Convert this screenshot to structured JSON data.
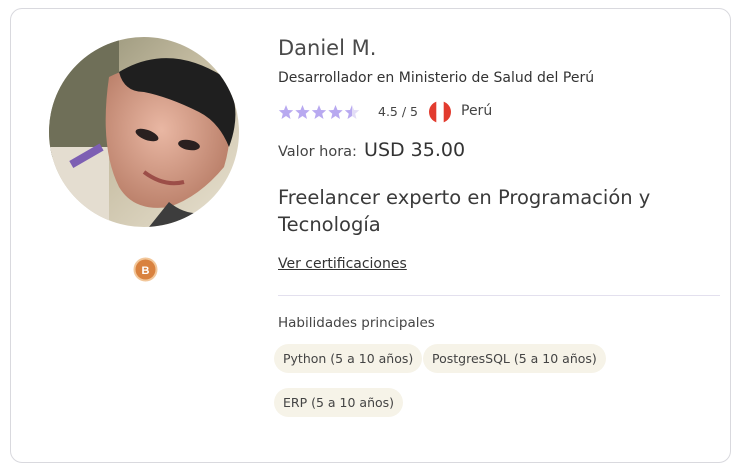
{
  "profile": {
    "name": "Daniel M.",
    "role": "Desarrollador en Ministerio de Salud del Perú",
    "rating": 4.5,
    "rating_text": "4.5 / 5",
    "country": "Perú",
    "rate_label": "Valor hora:",
    "rate_value": "USD 35.00",
    "headline": "Freelancer experto en Programación y Tecnología",
    "cert_link": "Ver certificaciones",
    "badge_letter": "B",
    "skills_title": "Habilidades principales",
    "skills": [
      "Python (5 a 10 años)",
      "PostgresSQL (5 a 10 años)",
      "ERP (5 a 10 años)"
    ]
  },
  "colors": {
    "star": "#b8a9f0",
    "badge": "#d9823f",
    "chip_bg": "#f6f3e8",
    "flag_red": "#e23b2e",
    "divider": "#e3e0ee"
  },
  "icons": {
    "star": "star-icon",
    "flag": "peru-flag-icon",
    "badge": "level-badge-icon"
  }
}
